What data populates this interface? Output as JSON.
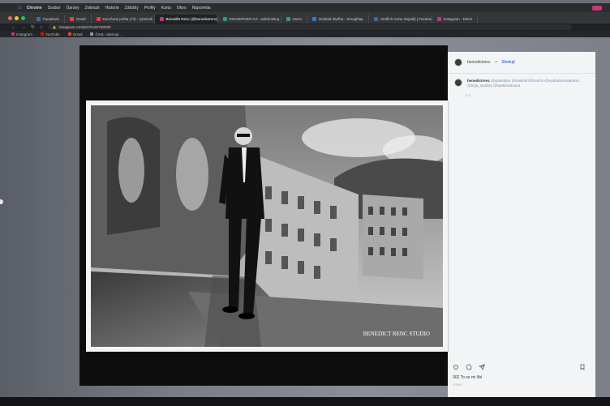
{
  "menubar": {
    "app": "Chrome",
    "items": [
      "Soubor",
      "Úpravy",
      "Zobrazit",
      "Historie",
      "Záložky",
      "Profily",
      "Karta",
      "Okno",
      "Nápověda"
    ]
  },
  "tabs": [
    {
      "label": "Facebook",
      "favicon_color": "#4267b2",
      "active": false
    },
    {
      "label": "Gmail",
      "favicon_color": "#ea4335",
      "active": false
    },
    {
      "label": "Doručená pošta (73) - rybnicek",
      "favicon_color": "#ea4335",
      "active": false
    },
    {
      "label": "Benedikt Renc (@benedictrenc)",
      "favicon_color": "#c13584",
      "active": true
    },
    {
      "label": "DIGISERVER.CZ - webhosting",
      "favicon_color": "#28a36a",
      "active": false
    },
    {
      "label": "Users",
      "favicon_color": "#28a36a",
      "active": false
    },
    {
      "label": "iDoklad Služba - Smoghlup",
      "favicon_color": "#2d7bd4",
      "active": false
    },
    {
      "label": "Jindřich Guha Nejedlý | Facebook",
      "favicon_color": "#4267b2",
      "active": false
    },
    {
      "label": "Instagram - Direct",
      "favicon_color": "#c13584",
      "active": false
    }
  ],
  "address_bar": {
    "url": "instagram.com/p/CPvnD7MZ30/"
  },
  "bookmarks": [
    {
      "label": "Instagram",
      "favicon_color": "#c13584"
    },
    {
      "label": "YouTube",
      "favicon_color": "#ff0000"
    },
    {
      "label": "Gmail",
      "favicon_color": "#ea4335"
    },
    {
      "label": "Česk. nástroje...",
      "favicon_color": "#999999"
    }
  ],
  "post": {
    "username": "benedictrenc",
    "follow_label": "Sledují",
    "caption": "@spekatkar @vladimirzhibrachs @nyubabenmadness @triga_spoilsty @spektivsavana",
    "timestamp": "3 d",
    "likes": "302 To se mi líbí",
    "posted": "3 DNY",
    "watermark": "BENEDICT RENC STUDIO"
  }
}
